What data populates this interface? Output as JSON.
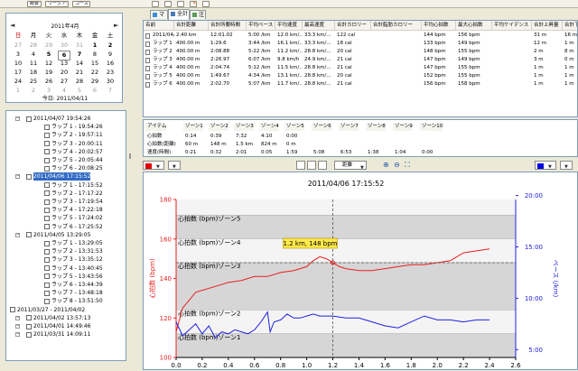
{
  "toolbar": {
    "buttons": [
      "概要",
      "ワークアウト",
      "コース"
    ]
  },
  "calendar": {
    "title": "2011年4月",
    "prev": "◄",
    "next": "►",
    "weekdays": [
      "日",
      "月",
      "火",
      "水",
      "木",
      "金",
      "土"
    ],
    "rows": [
      [
        "27",
        "28",
        "29",
        "30",
        "31",
        "1",
        "2"
      ],
      [
        "3",
        "4",
        "5",
        "6",
        "7",
        "8",
        "9"
      ],
      [
        "10",
        "11",
        "12",
        "13",
        "14",
        "15",
        "16"
      ],
      [
        "17",
        "18",
        "19",
        "20",
        "21",
        "22",
        "23"
      ],
      [
        "24",
        "25",
        "26",
        "27",
        "28",
        "29",
        "30"
      ],
      [
        "1",
        "2",
        "3",
        "4",
        "5",
        "6",
        "7"
      ]
    ],
    "bold_days": [
      "1",
      "2",
      "5",
      "6",
      "7"
    ],
    "today_label": "今日: 2011/04/11"
  },
  "tree": {
    "items": [
      {
        "label": "2011/04/07 19:54:26",
        "level": 0,
        "selected": false
      },
      {
        "label": "ラップ 1 - 19:54:26",
        "level": 1,
        "selected": false
      },
      {
        "label": "ラップ 2 - 19:57:11",
        "level": 1,
        "selected": false
      },
      {
        "label": "ラップ 3 - 20:00:11",
        "level": 1,
        "selected": false
      },
      {
        "label": "ラップ 4 - 20:02:57",
        "level": 1,
        "selected": false
      },
      {
        "label": "ラップ 5 - 20:05:44",
        "level": 1,
        "selected": false
      },
      {
        "label": "ラップ 6 - 20:08:25",
        "level": 1,
        "selected": false
      },
      {
        "label": "2011/04/06 17:15:52",
        "level": 0,
        "selected": true
      },
      {
        "label": "ラップ 1 - 17:15:52",
        "level": 1,
        "selected": false
      },
      {
        "label": "ラップ 2 - 17:17:22",
        "level": 1,
        "selected": false
      },
      {
        "label": "ラップ 3 - 17:19:54",
        "level": 1,
        "selected": false
      },
      {
        "label": "ラップ 4 - 17:22:18",
        "level": 1,
        "selected": false
      },
      {
        "label": "ラップ 5 - 17:24:02",
        "level": 1,
        "selected": false
      },
      {
        "label": "ラップ 6 - 17:25:52",
        "level": 1,
        "selected": false
      },
      {
        "label": "2011/04/05 13:29:05",
        "level": 0,
        "selected": false
      },
      {
        "label": "ラップ 1 - 13:29:05",
        "level": 1,
        "selected": false
      },
      {
        "label": "ラップ 2 - 13:31:53",
        "level": 1,
        "selected": false
      },
      {
        "label": "ラップ 3 - 13:35:12",
        "level": 1,
        "selected": false
      },
      {
        "label": "ラップ 4 - 13:40:45",
        "level": 1,
        "selected": false
      },
      {
        "label": "ラップ 5 - 13:43:56",
        "level": 1,
        "selected": false
      },
      {
        "label": "ラップ 6 - 13:44:39",
        "level": 1,
        "selected": false
      },
      {
        "label": "ラップ 7 - 13:48:18",
        "level": 1,
        "selected": false
      },
      {
        "label": "ラップ 8 - 13:51:50",
        "level": 1,
        "selected": false
      },
      {
        "label": "2011/03/27 - 2011/04/02",
        "level": -1,
        "selected": false
      },
      {
        "label": "2011/04/02 13:57:13",
        "level": 0,
        "selected": false
      },
      {
        "label": "2011/04/01 14:49:46",
        "level": 0,
        "selected": false
      },
      {
        "label": "2011/03/31 14:09:11",
        "level": 0,
        "selected": false
      }
    ]
  },
  "tabs": [
    "マップ",
    "全計",
    "注"
  ],
  "lap_table": {
    "headers": [
      "名前",
      "合計距離",
      "合計所要時間",
      "平均ペース",
      "平均速度",
      "最高速度",
      "合計カロリー",
      "合計脂肪カロリー",
      "平均心拍数",
      "最大心拍数",
      "平均ケイデンス",
      "合計上昇量",
      "合計下降"
    ],
    "rows": [
      [
        "2011/04/...",
        "2.40 km",
        "12:01.02",
        "5:00 /km",
        "12.0 km/...",
        "33.3 km/...",
        "122 cal",
        "",
        "144 bpm",
        "156 bpm",
        "",
        "31 m",
        "16 m"
      ],
      [
        "ラップ 1",
        "400.00 m",
        "1:29.6",
        "3:44 /km",
        "16.1 km/...",
        "33.3 km/...",
        "18 cal",
        "",
        "133 bpm",
        "149 bpm",
        "",
        "12 m",
        "1 m"
      ],
      [
        "ラップ 2",
        "400.00 m",
        "2:08.88",
        "5:22 /km",
        "11.2 km/...",
        "28.8 km/...",
        "20 cal",
        "",
        "148 bpm",
        "155 bpm",
        "",
        "2 m",
        "8 m"
      ],
      [
        "ラップ 3",
        "400.00 m",
        "2:26.97",
        "6:07 /km",
        "9.8 km/h",
        "24.9 km/...",
        "21 cal",
        "",
        "147 bpm",
        "149 bpm",
        "",
        "3 m",
        "0 m"
      ],
      [
        "ラップ 4",
        "400.00 m",
        "2:04.74",
        "5:12 /km",
        "11.5 km/...",
        "28.8 km/...",
        "21 cal",
        "",
        "147 bpm",
        "155 bpm",
        "",
        "1 m",
        "1 m"
      ],
      [
        "ラップ 5",
        "400.00 m",
        "1:49.67",
        "4:34 /km",
        "13.1 km/...",
        "28.8 km/...",
        "20 cal",
        "",
        "152 bpm",
        "155 bpm",
        "",
        "1 m",
        "1 m"
      ],
      [
        "ラップ 6",
        "400.00 m",
        "2:02.70",
        "5:07 /km",
        "11.7 km/...",
        "28.8 km/...",
        "21 cal",
        "",
        "156 bpm",
        "158 bpm",
        "",
        "1 m",
        "1 m"
      ]
    ]
  },
  "zone_table": {
    "headers": [
      "アイテム",
      "ゾーン1",
      "ゾーン2",
      "ゾーン3",
      "ゾーン4",
      "ゾーン5",
      "ゾーン6",
      "ゾーン7",
      "ゾーン8",
      "ゾーン9",
      "ゾーン10"
    ],
    "rows": [
      [
        "心拍数",
        "0:14",
        "0:39",
        "7:32",
        "4:10",
        "0:00",
        "",
        "",
        "",
        "",
        ""
      ],
      [
        "心拍数(距離)",
        "60 m",
        "148 m",
        "1.5 km",
        "824 m",
        "0 m",
        "",
        "",
        "",
        "",
        ""
      ],
      [
        "速度(時間)",
        "0:21",
        "0:32",
        "2:01",
        "0:05",
        "1:59",
        "5:08",
        "6:53",
        "1:38",
        "1:04",
        "0:00"
      ]
    ]
  },
  "chart_toolbar": {
    "x_axis_select": "距離",
    "left_color": "#e00000",
    "right_color": "#0000e0"
  },
  "chart_data": {
    "type": "line",
    "title": "2011/04/06 17:15:52",
    "xlabel": "距離 (km)",
    "ylabel_left": "心拍数 (bpm)",
    "ylabel_right": "ペース (/km)",
    "xlim": [
      0,
      2.6
    ],
    "ylim_left": [
      100,
      180
    ],
    "x_ticks": [
      "0.0",
      "0.2",
      "0.4",
      "0.6",
      "0.8",
      "1.0",
      "1.2",
      "1.4",
      "1.6",
      "1.8",
      "2.0",
      "2.2",
      "2.4",
      "2.6"
    ],
    "y_ticks_left": [
      "100",
      "120",
      "140",
      "160",
      "180"
    ],
    "y_ticks_right": [
      "5:00",
      "10:00",
      "15:00",
      "20:00"
    ],
    "y_ticks_right_positions_bpm": [
      104,
      130,
      156,
      182
    ],
    "zones": [
      {
        "label": "心拍数 (bpm)ゾーン1",
        "from": 100,
        "to": 112
      },
      {
        "label": "心拍数 (bpm)ゾーン2",
        "from": 112,
        "to": 124
      },
      {
        "label": "心拍数 (bpm)ゾーン3",
        "from": 124,
        "to": 148
      },
      {
        "label": "心拍数 (bpm)ゾーン4",
        "from": 148,
        "to": 160
      },
      {
        "label": "心拍数 (bpm)ゾーン5",
        "from": 160,
        "to": 172
      }
    ],
    "cursor": {
      "x": 1.2,
      "y": 148,
      "label": "1.2 km, 148 bpm"
    },
    "series": [
      {
        "name": "心拍数",
        "color": "#e82020",
        "points": [
          [
            0.0,
            113
          ],
          [
            0.05,
            125
          ],
          [
            0.1,
            129
          ],
          [
            0.15,
            133
          ],
          [
            0.2,
            134
          ],
          [
            0.3,
            136
          ],
          [
            0.4,
            138
          ],
          [
            0.5,
            139
          ],
          [
            0.6,
            141
          ],
          [
            0.7,
            141
          ],
          [
            0.8,
            143
          ],
          [
            0.9,
            144
          ],
          [
            1.0,
            146
          ],
          [
            1.05,
            149
          ],
          [
            1.1,
            151
          ],
          [
            1.15,
            150
          ],
          [
            1.2,
            148
          ],
          [
            1.25,
            146
          ],
          [
            1.3,
            145
          ],
          [
            1.4,
            144
          ],
          [
            1.5,
            144
          ],
          [
            1.6,
            145
          ],
          [
            1.7,
            146
          ],
          [
            1.8,
            147
          ],
          [
            1.9,
            147
          ],
          [
            2.0,
            148
          ],
          [
            2.1,
            149
          ],
          [
            2.15,
            151
          ],
          [
            2.2,
            153
          ],
          [
            2.3,
            154
          ],
          [
            2.4,
            155
          ]
        ]
      },
      {
        "name": "ペース",
        "color": "#2020e0",
        "points": [
          [
            0.0,
            118
          ],
          [
            0.05,
            111
          ],
          [
            0.1,
            114
          ],
          [
            0.15,
            117
          ],
          [
            0.2,
            112
          ],
          [
            0.25,
            116
          ],
          [
            0.3,
            110
          ],
          [
            0.35,
            113
          ],
          [
            0.4,
            112
          ],
          [
            0.45,
            114
          ],
          [
            0.5,
            113
          ],
          [
            0.55,
            112
          ],
          [
            0.6,
            114
          ],
          [
            0.65,
            118
          ],
          [
            0.7,
            123
          ],
          [
            0.72,
            113
          ],
          [
            0.75,
            118
          ],
          [
            0.8,
            119
          ],
          [
            0.85,
            122
          ],
          [
            0.9,
            120
          ],
          [
            0.95,
            120
          ],
          [
            1.0,
            121
          ],
          [
            1.05,
            122
          ],
          [
            1.1,
            121
          ],
          [
            1.2,
            121
          ],
          [
            1.3,
            120
          ],
          [
            1.4,
            120
          ],
          [
            1.5,
            118
          ],
          [
            1.6,
            116
          ],
          [
            1.7,
            115
          ],
          [
            1.8,
            118
          ],
          [
            1.9,
            121
          ],
          [
            2.0,
            119
          ],
          [
            2.1,
            119
          ],
          [
            2.2,
            118
          ],
          [
            2.3,
            119
          ],
          [
            2.4,
            119
          ]
        ]
      }
    ]
  }
}
